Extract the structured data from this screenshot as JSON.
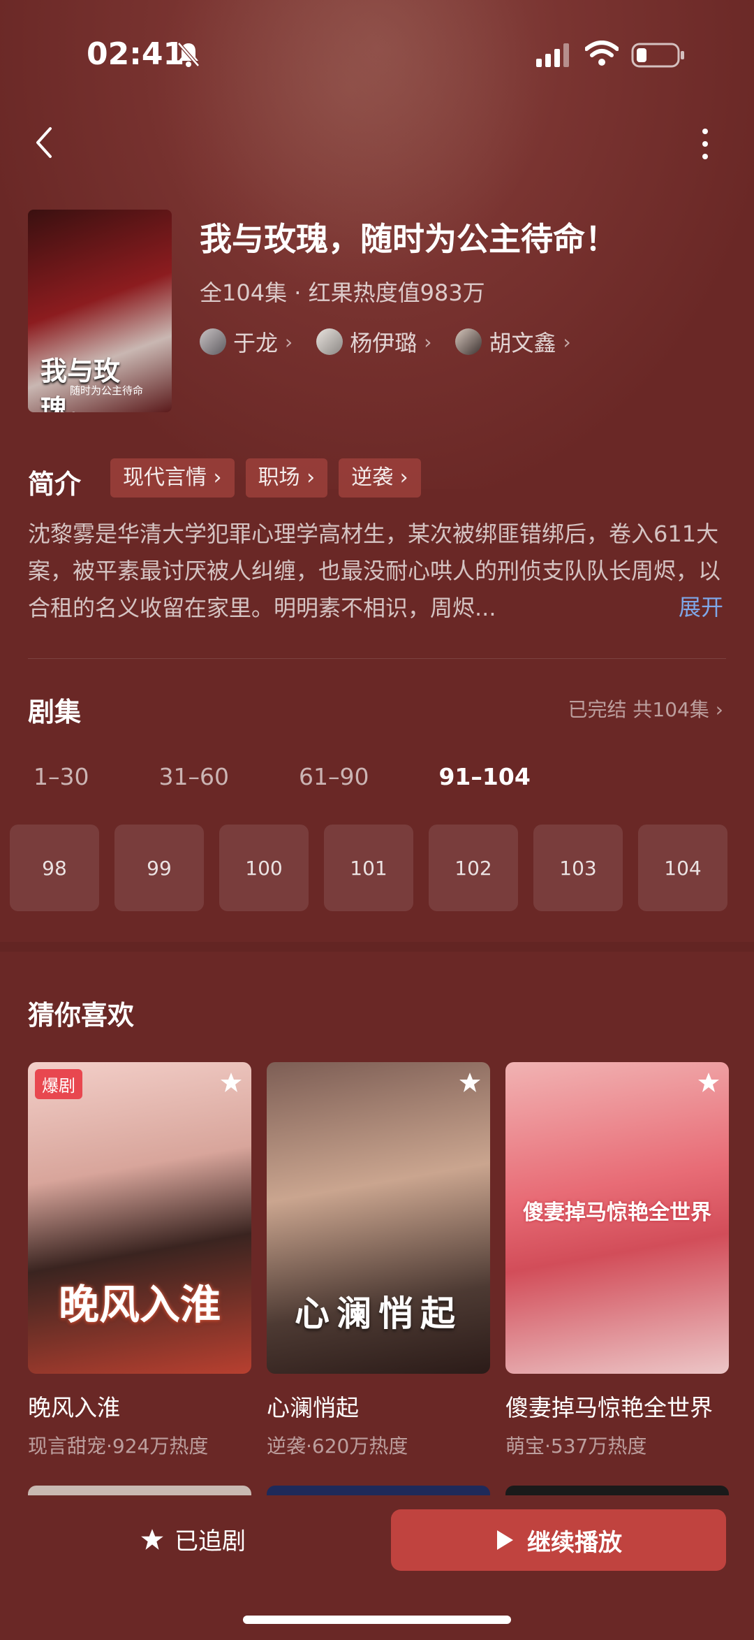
{
  "status": {
    "time": "02:41"
  },
  "drama": {
    "title": "我与玫瑰，随时为公主待命！",
    "meta": "全104集 · 红果热度值983万",
    "poster_title": "我与玫瑰，",
    "poster_sub": "随时为公主待命",
    "actors": [
      "于龙",
      "杨伊璐",
      "胡文鑫"
    ]
  },
  "intro": {
    "label": "简介",
    "tags": [
      "现代言情",
      "职场",
      "逆袭"
    ],
    "synopsis": "沈黎雾是华清大学犯罪心理学高材生，某次被绑匪错绑后，卷入611大案，被平素最讨厌被人纠缠，也最没耐心哄人的刑侦支队队长周烬，以合租的名义收留在家里。明明素不相识，周烬...",
    "expand": "展开"
  },
  "episodes": {
    "title": "剧集",
    "status": "已完结 共104集",
    "ranges": [
      "1–30",
      "31–60",
      "61–90",
      "91–104"
    ],
    "active_range": 3,
    "numbers": [
      "98",
      "99",
      "100",
      "101",
      "102",
      "103",
      "104"
    ]
  },
  "recommend": {
    "title": "猜你喜欢",
    "items": [
      {
        "name": "晚风入淮",
        "meta": "现言甜宠·924万热度",
        "badge": "爆剧",
        "cover_text": "晚风入淮"
      },
      {
        "name": "心澜悄起",
        "meta": "逆袭·620万热度",
        "cover_text": "心澜悄起"
      },
      {
        "name": "傻妻掉马惊艳全世界",
        "meta": "萌宝·537万热度",
        "cover_text": "傻妻掉马惊艳全世界"
      }
    ]
  },
  "bottom": {
    "follow": "已追剧",
    "play": "继续播放"
  },
  "colors": {
    "background": "#6a2826",
    "accent": "#c0433f",
    "link": "#7fa7e8"
  }
}
